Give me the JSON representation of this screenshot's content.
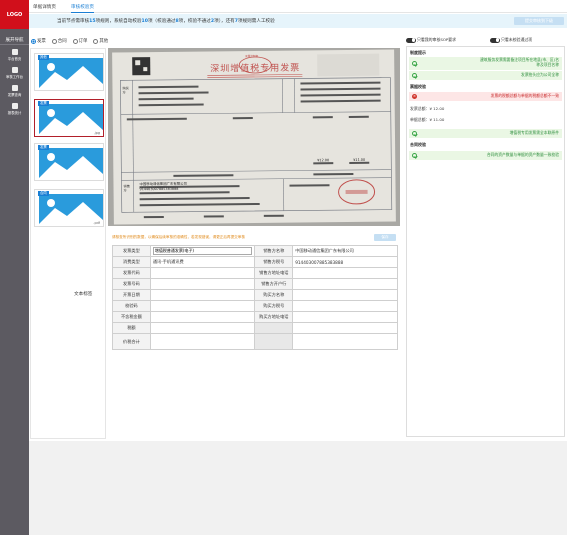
{
  "logo": "LOGO",
  "nav": {
    "title": "展开导航",
    "items": [
      {
        "label": "平台首页"
      },
      {
        "label": "审核工作台"
      },
      {
        "label": "发票查询"
      },
      {
        "label": "报表统计"
      }
    ]
  },
  "tabs": [
    {
      "label": "单据详情页"
    },
    {
      "label": "审核校验页"
    }
  ],
  "info": {
    "prefix": "当前节点需审核",
    "count1": "15",
    "mid1": "项规则，系统自动校验",
    "count2": "10",
    "mid2": "项（校验通过",
    "pass": "8",
    "mid3": "项，校验不通过",
    "fail": "2",
    "mid4": "项），还有",
    "remain": "7",
    "suffix": "项规则需人工校验",
    "submit": "提交审核到下级"
  },
  "types": [
    {
      "label": "发票",
      "checked": true
    },
    {
      "label": "合同",
      "checked": false
    },
    {
      "label": "订单",
      "checked": false
    },
    {
      "label": "其他",
      "checked": false
    }
  ],
  "thumbs": [
    {
      "tag": "其他",
      "ext": ""
    },
    {
      "tag": "发票",
      "ext": ".jpg"
    },
    {
      "tag": "发票",
      "ext": ""
    },
    {
      "tag": "合同",
      "ext": ".pdf"
    }
  ],
  "text_mark": "文本标签",
  "invoice": {
    "title": "深圳增值税专用发票",
    "stamp": "发票监制章",
    "buyer_label": "购买方",
    "seller_label": "销售方",
    "seller_name": "中国移动通信集团广东有限公司",
    "taxno": "914403007885383888",
    "amount": "¥12.00",
    "tax": "¥11.00"
  },
  "warn": {
    "text": "请核查所识别的数据，以确保后续审核的准确性，若发现错误，请更正后再提交审核",
    "button": "保存"
  },
  "form": {
    "rows": [
      {
        "l1": "发票类型",
        "v1": "增值税普通发票(电子)",
        "l2": "销售方名称",
        "v2": "中国移动通信集团广东有限公司"
      },
      {
        "l1": "消费类型",
        "v1": "通讯-手机通讯费",
        "l2": "销售方税号",
        "v2": "914403007885383888"
      },
      {
        "l1": "发票代码",
        "v1": "",
        "l2": "销售方地址电话",
        "v2": ""
      },
      {
        "l1": "发票号码",
        "v1": "",
        "l2": "销售方开户行",
        "v2": ""
      },
      {
        "l1": "开票日期",
        "v1": "",
        "l2": "购买方名称",
        "v2": ""
      },
      {
        "l1": "校验码",
        "v1": "",
        "l2": "购买方税号",
        "v2": ""
      },
      {
        "l1": "不含税金额",
        "v1": "",
        "l2": "购买方地址电话",
        "v2": ""
      },
      {
        "l1": "税额",
        "v1": "",
        "l2": "",
        "v2": ""
      },
      {
        "l1": "价税合计",
        "v1": "",
        "l2": "",
        "v2": ""
      }
    ]
  },
  "toggles": [
    {
      "label": "只看我的审核SOP要求"
    },
    {
      "label": "只看未校验通过项"
    }
  ],
  "rules": {
    "s1": "制度提示",
    "r1": "建筑服务发票需要备注项目所在地县(市、区)名称及项目名称",
    "r2": "发票抬头应为公司全称",
    "s2": "票据校验",
    "r3": "发票的税额总额与单据的税额总额不一致",
    "a1_label": "发票总额：",
    "a1_value": "¥ 12.00",
    "a2_label": "单据总额：",
    "a2_value": "¥ 11.00",
    "r4": "增值税专用发票需全本联原件",
    "s3": "合同校验",
    "r5": "合同的资产数量与单据的资产数量一致校验"
  }
}
